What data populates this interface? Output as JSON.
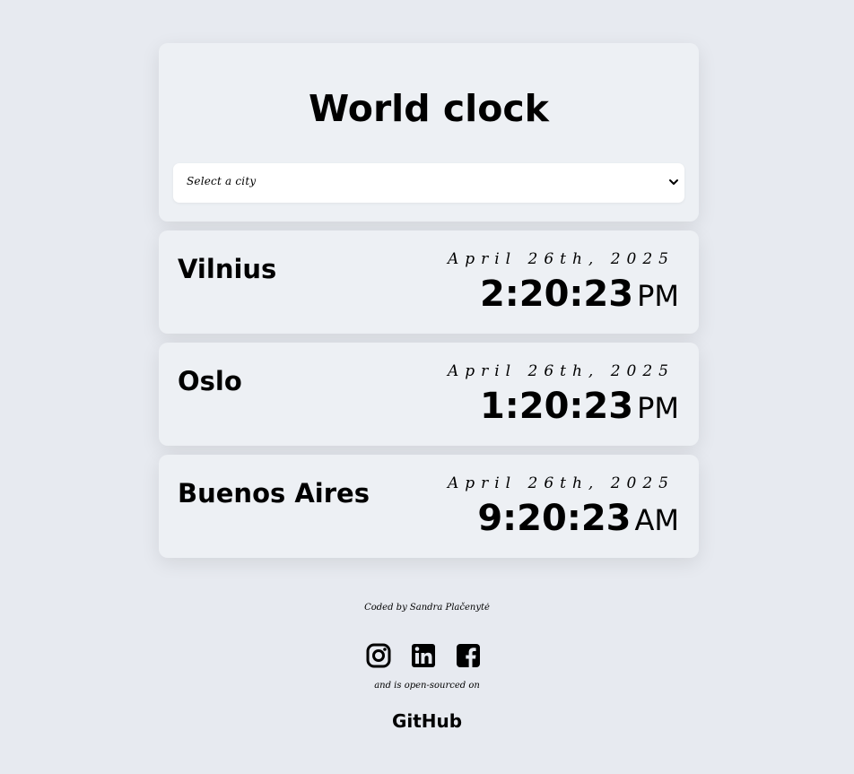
{
  "header": {
    "title": "World clock",
    "select_placeholder": "Select a city"
  },
  "cities": [
    {
      "name": "Vilnius",
      "date": "April 26th, 2025",
      "time": "2:20:23",
      "ampm": "PM"
    },
    {
      "name": "Oslo",
      "date": "April 26th, 2025",
      "time": "1:20:23",
      "ampm": "PM"
    },
    {
      "name": "Buenos Aires",
      "date": "April 26th, 2025",
      "time": "9:20:23",
      "ampm": "AM"
    }
  ],
  "footer": {
    "credit": "Coded by Sandra Plačenytė",
    "social_icons": [
      "instagram-icon",
      "linkedin-icon",
      "facebook-icon"
    ],
    "open_source_text": "and is open-sourced on",
    "github_label": "GitHub"
  },
  "colors": {
    "background": "#e7eaf0",
    "card": "#edf0f4",
    "text": "#000000"
  }
}
